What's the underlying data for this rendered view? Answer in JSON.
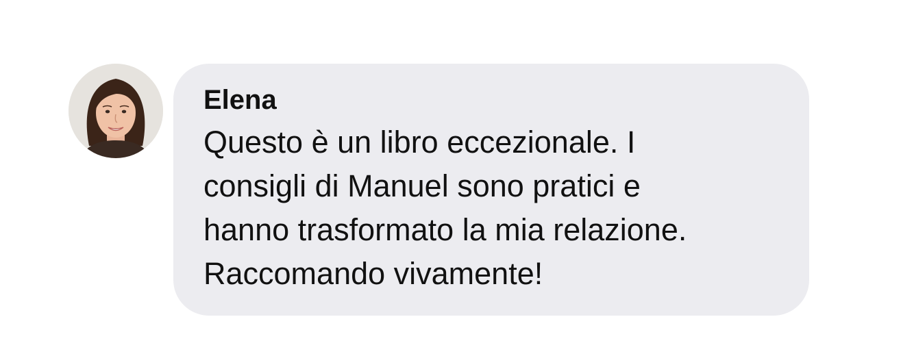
{
  "message": {
    "sender_name": "Elena",
    "lines": [
      "Questo è un libro eccezionale. I",
      "consigli di Manuel sono pratici e",
      "hanno trasformato la mia relazione.",
      "Raccomando vivamente!"
    ]
  },
  "avatar": {
    "icon": "user-avatar-photo"
  },
  "colors": {
    "bubble_background": "#ececf0",
    "text": "#111111",
    "page_background": "#ffffff"
  }
}
